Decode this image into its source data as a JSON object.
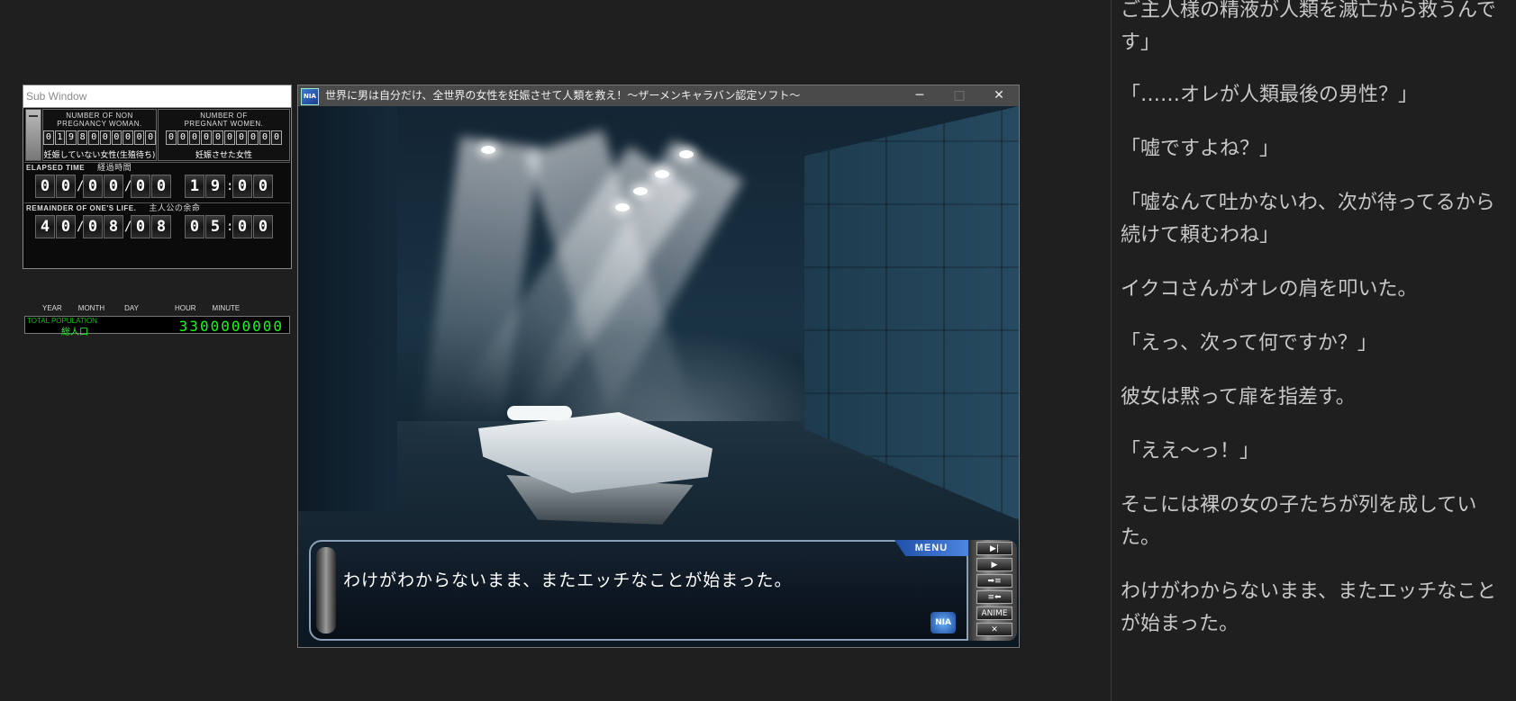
{
  "sub_window": {
    "title": "Sub Window",
    "non_pregnant": {
      "label_en_1": "NUMBER OF NON",
      "label_en_2": "PREGNANCY WOMAN.",
      "digits": [
        "0",
        "1",
        "9",
        "8",
        "0",
        "0",
        "0",
        "0",
        "0",
        "0"
      ],
      "label_jp": "妊娠していない女性(生殖待ち)"
    },
    "pregnant": {
      "label_en_1": "NUMBER OF",
      "label_en_2": "PREGNANT WOMEN.",
      "digits": [
        "0",
        "0",
        "0",
        "0",
        "0",
        "0",
        "0",
        "0",
        "0",
        "0"
      ],
      "label_jp": "妊娠させた女性"
    },
    "elapsed": {
      "label_en": "ELAPSED TIME",
      "label_jp": "経過時間",
      "date": [
        "0",
        "0",
        "0",
        "0",
        "0",
        "0"
      ],
      "time": [
        "1",
        "9",
        "0",
        "0"
      ]
    },
    "remainder": {
      "label_en": "REMAINDER OF ONE'S LIFE.",
      "label_jp": "主人公の余命",
      "date": [
        "4",
        "0",
        "0",
        "8",
        "0",
        "8"
      ],
      "time": [
        "0",
        "5",
        "0",
        "0"
      ]
    },
    "units": [
      "YEAR",
      "MONTH",
      "DAY",
      "HOUR",
      "MINUTE"
    ],
    "date_sep": "/",
    "time_sep": ":",
    "population": {
      "label_en": "TOTAL POPULATION",
      "label_jp": "総人口",
      "value": "3300000000"
    }
  },
  "game_window": {
    "title": "世界に男は自分だけ、全世界の女性を妊娠させて人類を救え！～ザーメンキャラバン認定ソフト～",
    "icon_text": "NIA",
    "minimize": "─",
    "maximize": "□",
    "close": "✕",
    "menu_label": "MENU",
    "message": "わけがわからないまま、またエッチなことが始まった。",
    "logo_text": "NIA",
    "controls": [
      {
        "name": "skip-button",
        "label": "▶|"
      },
      {
        "name": "auto-button",
        "label": "▶"
      },
      {
        "name": "save-button",
        "label": "➡≡"
      },
      {
        "name": "load-button",
        "label": "≡⬅"
      },
      {
        "name": "anime-button",
        "label": "ANIME"
      },
      {
        "name": "close-game-button",
        "label": "✕"
      }
    ]
  },
  "log": {
    "paragraphs": [
      {
        "text": "ご主人様の精液が人類を滅亡から救うんです」"
      },
      {
        "text": "「……オレが人類最後の男性？」"
      },
      {
        "text": "「嘘ですよね？」"
      },
      {
        "text": "「嘘なんて吐かないわ、次が待ってるから続けて頼むわね」"
      },
      {
        "text": "イクコさんがオレの肩を叩いた。"
      },
      {
        "text": "「えっ、次って何ですか？」"
      },
      {
        "text": "彼女は黙って扉を指差す。"
      },
      {
        "text": "「ええ～っ！」"
      },
      {
        "text": "そこには裸の女の子たちが列を成していた。"
      },
      {
        "text": "わけがわからないまま、またエッチなことが始まった。"
      }
    ]
  }
}
